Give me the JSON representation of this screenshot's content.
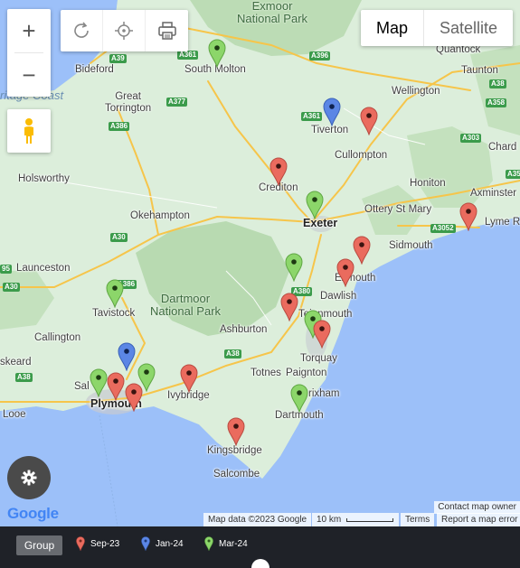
{
  "controls": {
    "zoom_in": "+",
    "zoom_out": "−",
    "map_label": "Map",
    "satellite_label": "Satellite"
  },
  "places": [
    {
      "id": "exmoor-national-park",
      "text": "Exmoor\nNational Park",
      "kind": "park"
    },
    {
      "id": "bideford",
      "text": "Bideford",
      "kind": "town"
    },
    {
      "id": "south-molton",
      "text": "South Molton",
      "kind": "town"
    },
    {
      "id": "taunton",
      "text": "Taunton",
      "kind": "town"
    },
    {
      "id": "wellington",
      "text": "Wellington",
      "kind": "town"
    },
    {
      "id": "great-torrington",
      "text": "Great\nTorrington",
      "kind": "town"
    },
    {
      "id": "tiverton",
      "text": "Tiverton",
      "kind": "town"
    },
    {
      "id": "cullompton",
      "text": "Cullompton",
      "kind": "town"
    },
    {
      "id": "chard",
      "text": "Chard",
      "kind": "town"
    },
    {
      "id": "holsworthy",
      "text": "Holsworthy",
      "kind": "town"
    },
    {
      "id": "crediton",
      "text": "Crediton",
      "kind": "town"
    },
    {
      "id": "honiton",
      "text": "Honiton",
      "kind": "town"
    },
    {
      "id": "axminster",
      "text": "Axminster",
      "kind": "town"
    },
    {
      "id": "okehampton",
      "text": "Okehampton",
      "kind": "town"
    },
    {
      "id": "exeter",
      "text": "Exeter",
      "kind": "city"
    },
    {
      "id": "ottery-st-mary",
      "text": "Ottery St Mary",
      "kind": "town"
    },
    {
      "id": "lyme-regis",
      "text": "Lyme R",
      "kind": "town"
    },
    {
      "id": "sidmouth",
      "text": "Sidmouth",
      "kind": "town"
    },
    {
      "id": "launceston",
      "text": "Launceston",
      "kind": "town"
    },
    {
      "id": "exmouth",
      "text": "Exmouth",
      "kind": "town"
    },
    {
      "id": "dawlish",
      "text": "Dawlish",
      "kind": "town"
    },
    {
      "id": "tavistock",
      "text": "Tavistock",
      "kind": "town"
    },
    {
      "id": "dartmoor-national-park",
      "text": "Dartmoor\nNational Park",
      "kind": "park"
    },
    {
      "id": "teignmouth",
      "text": "Teignmouth",
      "kind": "town"
    },
    {
      "id": "ashburton",
      "text": "Ashburton",
      "kind": "town"
    },
    {
      "id": "callington",
      "text": "Callington",
      "kind": "town"
    },
    {
      "id": "torquay",
      "text": "Torquay",
      "kind": "town"
    },
    {
      "id": "liskeard",
      "text": "skeard",
      "kind": "town"
    },
    {
      "id": "totnes",
      "text": "Totnes",
      "kind": "town"
    },
    {
      "id": "paignton",
      "text": "Paignton",
      "kind": "town"
    },
    {
      "id": "saltash",
      "text": "Sal",
      "kind": "town"
    },
    {
      "id": "plymouth",
      "text": "Plymouth",
      "kind": "city"
    },
    {
      "id": "ivybridge",
      "text": "Ivybridge",
      "kind": "town"
    },
    {
      "id": "brixham",
      "text": "rixham",
      "kind": "town"
    },
    {
      "id": "looe",
      "text": "Looe",
      "kind": "town"
    },
    {
      "id": "dartmouth",
      "text": "Dartmouth",
      "kind": "town"
    },
    {
      "id": "kingsbridge",
      "text": "Kingsbridge",
      "kind": "town"
    },
    {
      "id": "salcombe",
      "text": "Salcombe",
      "kind": "town"
    },
    {
      "id": "quantock",
      "text": "Quantock",
      "kind": "town"
    },
    {
      "id": "heritage-coast",
      "text": "ritage Coast",
      "kind": "sea"
    }
  ],
  "roads": [
    {
      "id": "a361-north",
      "text": "A361",
      "color": "green"
    },
    {
      "id": "a39",
      "text": "A39",
      "color": "green"
    },
    {
      "id": "a396",
      "text": "A396",
      "color": "green"
    },
    {
      "id": "a38-north",
      "text": "A38",
      "color": "green"
    },
    {
      "id": "a358",
      "text": "A358",
      "color": "green"
    },
    {
      "id": "a377",
      "text": "A377",
      "color": "green"
    },
    {
      "id": "a386-north",
      "text": "A386",
      "color": "green"
    },
    {
      "id": "a361-tiverton",
      "text": "A361",
      "color": "green"
    },
    {
      "id": "a303",
      "text": "A303",
      "color": "green"
    },
    {
      "id": "a30-mid",
      "text": "A30",
      "color": "green"
    },
    {
      "id": "a3052",
      "text": "A3052",
      "color": "green"
    },
    {
      "id": "a35",
      "text": "A35",
      "color": "green"
    },
    {
      "id": "a30-west",
      "text": "A30",
      "color": "green"
    },
    {
      "id": "a386-south",
      "text": "A386",
      "color": "green"
    },
    {
      "id": "a380",
      "text": "A380",
      "color": "green"
    },
    {
      "id": "a38-south",
      "text": "A38",
      "color": "green"
    },
    {
      "id": "a38-west",
      "text": "A38",
      "color": "green"
    },
    {
      "id": "a30-edge",
      "text": "95",
      "color": "green"
    }
  ],
  "markers": [
    {
      "id": "marker-south-molton",
      "group": "Mar-24"
    },
    {
      "id": "marker-tiverton",
      "group": "Jan-24"
    },
    {
      "id": "marker-cullompton",
      "group": "Sep-23"
    },
    {
      "id": "marker-crediton",
      "group": "Sep-23"
    },
    {
      "id": "marker-exeter",
      "group": "Mar-24"
    },
    {
      "id": "marker-lyme",
      "group": "Sep-23"
    },
    {
      "id": "marker-exmouth-1",
      "group": "Sep-23"
    },
    {
      "id": "marker-exmouth-2",
      "group": "Sep-23"
    },
    {
      "id": "marker-a380",
      "group": "Mar-24"
    },
    {
      "id": "marker-tavistock",
      "group": "Mar-24"
    },
    {
      "id": "marker-newton-abbot",
      "group": "Sep-23"
    },
    {
      "id": "marker-teignmouth-1",
      "group": "Mar-24"
    },
    {
      "id": "marker-teignmouth-2",
      "group": "Sep-23"
    },
    {
      "id": "marker-plymouth-north",
      "group": "Jan-24"
    },
    {
      "id": "marker-plymouth-1",
      "group": "Mar-24"
    },
    {
      "id": "marker-plymouth-2",
      "group": "Sep-23"
    },
    {
      "id": "marker-plymouth-3",
      "group": "Sep-23"
    },
    {
      "id": "marker-plympton",
      "group": "Mar-24"
    },
    {
      "id": "marker-ivybridge",
      "group": "Sep-23"
    },
    {
      "id": "marker-dartmouth",
      "group": "Mar-24"
    },
    {
      "id": "marker-kingsbridge",
      "group": "Sep-23"
    }
  ],
  "attribution": {
    "logo": "Google",
    "map_data": "Map data ©2023 Google",
    "scale": "10 km",
    "terms": "Terms",
    "report": "Report a map error",
    "contact": "Contact map owner"
  },
  "legend": {
    "group_label": "Group",
    "items": [
      {
        "label": "Sep-23",
        "color": "#ea6b5e"
      },
      {
        "label": "Jan-24",
        "color": "#5b86e5"
      },
      {
        "label": "Mar-24",
        "color": "#8cd66a"
      }
    ]
  }
}
